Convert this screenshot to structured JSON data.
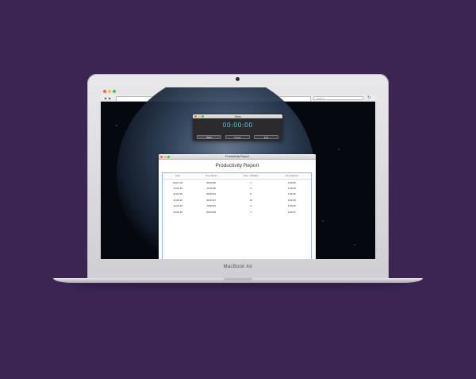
{
  "browser": {
    "window_title": "MacBook Air",
    "search_placeholder": "Search",
    "traffic_lights": [
      "#fc605c",
      "#fdbc40",
      "#34c84a"
    ]
  },
  "timer": {
    "window_title": "Timer",
    "display": "00:00:00",
    "display_color": "#4fc1e9",
    "buttons": {
      "start": "Start",
      "pause": "Pause",
      "end": "End"
    }
  },
  "report": {
    "window_title": "Productivity Report",
    "heading": "Productivity Report",
    "columns": [
      "Date",
      "Time Started",
      "Num. of Breaks",
      "Time Elapsed"
    ],
    "rows": [
      [
        "03-01-15",
        "08:45:56",
        "7",
        "1:50:45"
      ],
      [
        "11-03-15",
        "10:20:55",
        "3",
        "1:20:23"
      ],
      [
        "11-03-15",
        "08:05:51",
        "8",
        "1:41:50"
      ],
      [
        "11-05-15",
        "08:45:47",
        "10",
        "2:01:54"
      ],
      [
        "11-04-15",
        "10:50:01",
        "4",
        "1:00:50"
      ],
      [
        "11-05-15",
        "09:10:56",
        "7",
        "1:32:37"
      ]
    ]
  },
  "laptop": {
    "brand": "MacBook Air"
  }
}
